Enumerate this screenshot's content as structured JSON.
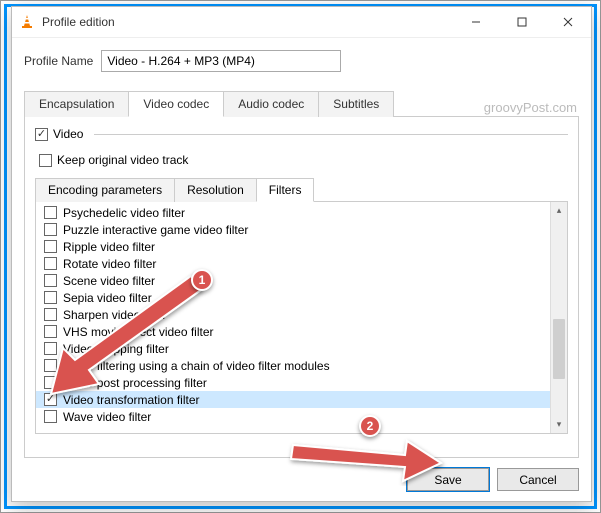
{
  "window": {
    "title": "Profile edition"
  },
  "profile": {
    "label": "Profile Name",
    "value": "Video - H.264 + MP3 (MP4)"
  },
  "watermark": "groovyPost.com",
  "mainTabs": {
    "t0": "Encapsulation",
    "t1": "Video codec",
    "t2": "Audio codec",
    "t3": "Subtitles"
  },
  "videoGroup": {
    "label": "Video",
    "keepOriginal": "Keep original video track"
  },
  "subTabs": {
    "s0": "Encoding parameters",
    "s1": "Resolution",
    "s2": "Filters"
  },
  "filters": {
    "f0": "Psychedelic video filter",
    "f1": "Puzzle interactive game video filter",
    "f2": "Ripple video filter",
    "f3": "Rotate video filter",
    "f4": "Scene video filter",
    "f5": "Sepia video filter",
    "f6": "Sharpen video filter",
    "f7": "VHS movie effect video filter",
    "f8": "Video cropping filter",
    "f9": "Video filtering using a chain of video filter modules",
    "f10": "Video post processing filter",
    "f11": "Video transformation filter",
    "f12": "Wave video filter"
  },
  "buttons": {
    "save": "Save",
    "cancel": "Cancel"
  },
  "annotations": {
    "badge1": "1",
    "badge2": "2"
  }
}
